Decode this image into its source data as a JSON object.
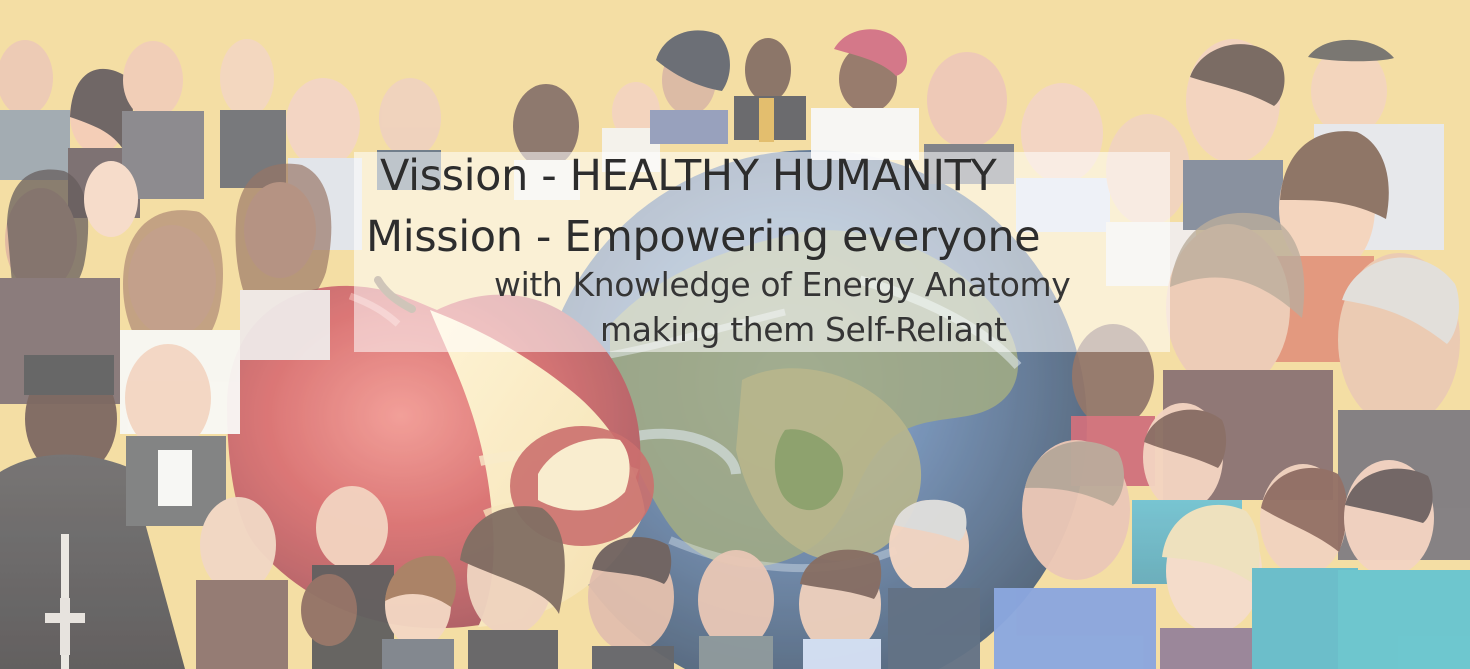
{
  "banner": {
    "vision_line": "Vission - HEALTHY HUMANITY",
    "mission_line": "Mission - Empowering everyone",
    "mission_line_2": "with Knowledge of Energy Anatomy",
    "mission_line_3": "making them Self-Reliant"
  },
  "colors": {
    "background": "#f2d27a",
    "panel": "#ffffff",
    "text": "#111111",
    "apple_red": "#c9363a",
    "globe_blue": "#2f5d8f",
    "globe_green": "#6f8a3e"
  }
}
